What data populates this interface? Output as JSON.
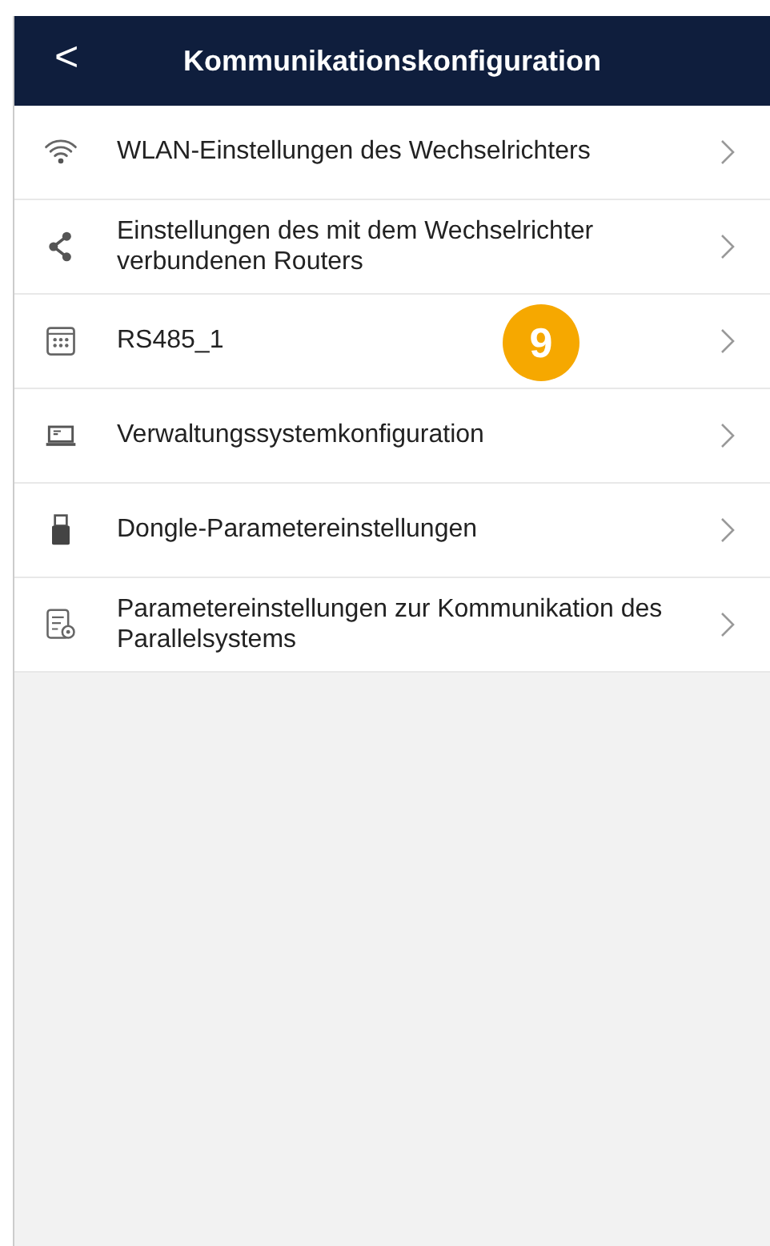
{
  "header": {
    "back": "<",
    "title": "Kommunikationskonfiguration"
  },
  "items": [
    {
      "kind": "wifi",
      "label": "WLAN-Einstellungen des Wechselrichters"
    },
    {
      "kind": "share",
      "label": "Einstellungen des mit dem Wechselrichter verbundenen Routers"
    },
    {
      "kind": "keypad",
      "label": "RS485_1"
    },
    {
      "kind": "laptop",
      "label": "Verwaltungssystemkonfiguration"
    },
    {
      "kind": "dongle",
      "label": "Dongle-Parametereinstellungen"
    },
    {
      "kind": "settings-doc",
      "label": "Parametereinstellungen zur Kommunikation des Parallelsystems"
    }
  ],
  "callout": "9"
}
